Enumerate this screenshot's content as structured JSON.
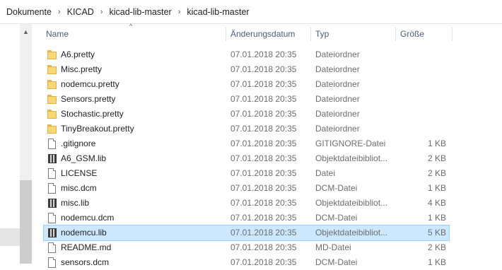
{
  "breadcrumb": [
    "Dokumente",
    "KICAD",
    "kicad-lib-master",
    "kicad-lib-master"
  ],
  "columns": {
    "name": "Name",
    "date": "Änderungsdatum",
    "type": "Typ",
    "size": "Größe"
  },
  "files": [
    {
      "name": "A6.pretty",
      "date": "07.01.2018 20:35",
      "type": "Dateiordner",
      "size": "",
      "icon": "folder-icon"
    },
    {
      "name": "Misc.pretty",
      "date": "07.01.2018 20:35",
      "type": "Dateiordner",
      "size": "",
      "icon": "folder-icon"
    },
    {
      "name": "nodemcu.pretty",
      "date": "07.01.2018 20:35",
      "type": "Dateiordner",
      "size": "",
      "icon": "folder-icon"
    },
    {
      "name": "Sensors.pretty",
      "date": "07.01.2018 20:35",
      "type": "Dateiordner",
      "size": "",
      "icon": "folder-icon"
    },
    {
      "name": "Stochastic.pretty",
      "date": "07.01.2018 20:35",
      "type": "Dateiordner",
      "size": "",
      "icon": "folder-icon"
    },
    {
      "name": "TinyBreakout.pretty",
      "date": "07.01.2018 20:35",
      "type": "Dateiordner",
      "size": "",
      "icon": "folder-icon"
    },
    {
      "name": ".gitignore",
      "date": "07.01.2018 20:35",
      "type": "GITIGNORE-Datei",
      "size": "1 KB",
      "icon": "file-icon"
    },
    {
      "name": "A6_GSM.lib",
      "date": "07.01.2018 20:35",
      "type": "Objektdateibibliot...",
      "size": "2 KB",
      "icon": "library-file-icon"
    },
    {
      "name": "LICENSE",
      "date": "07.01.2018 20:35",
      "type": "Datei",
      "size": "2 KB",
      "icon": "file-icon"
    },
    {
      "name": "misc.dcm",
      "date": "07.01.2018 20:35",
      "type": "DCM-Datei",
      "size": "1 KB",
      "icon": "file-icon"
    },
    {
      "name": "misc.lib",
      "date": "07.01.2018 20:35",
      "type": "Objektdateibibliot...",
      "size": "4 KB",
      "icon": "library-file-icon"
    },
    {
      "name": "nodemcu.dcm",
      "date": "07.01.2018 20:35",
      "type": "DCM-Datei",
      "size": "1 KB",
      "icon": "file-icon"
    },
    {
      "name": "nodemcu.lib",
      "date": "07.01.2018 20:35",
      "type": "Objektdateibibliot...",
      "size": "5 KB",
      "icon": "library-file-icon",
      "selected": true
    },
    {
      "name": "README.md",
      "date": "07.01.2018 20:35",
      "type": "MD-Datei",
      "size": "2 KB",
      "icon": "file-icon"
    },
    {
      "name": "sensors.dcm",
      "date": "07.01.2018 20:35",
      "type": "DCM-Datei",
      "size": "1 KB",
      "icon": "file-icon"
    }
  ],
  "colors": {
    "selection_bg": "#cce8ff",
    "selection_border": "#99d1ff",
    "folder": "#f8d775",
    "header_text": "#4c607a"
  }
}
